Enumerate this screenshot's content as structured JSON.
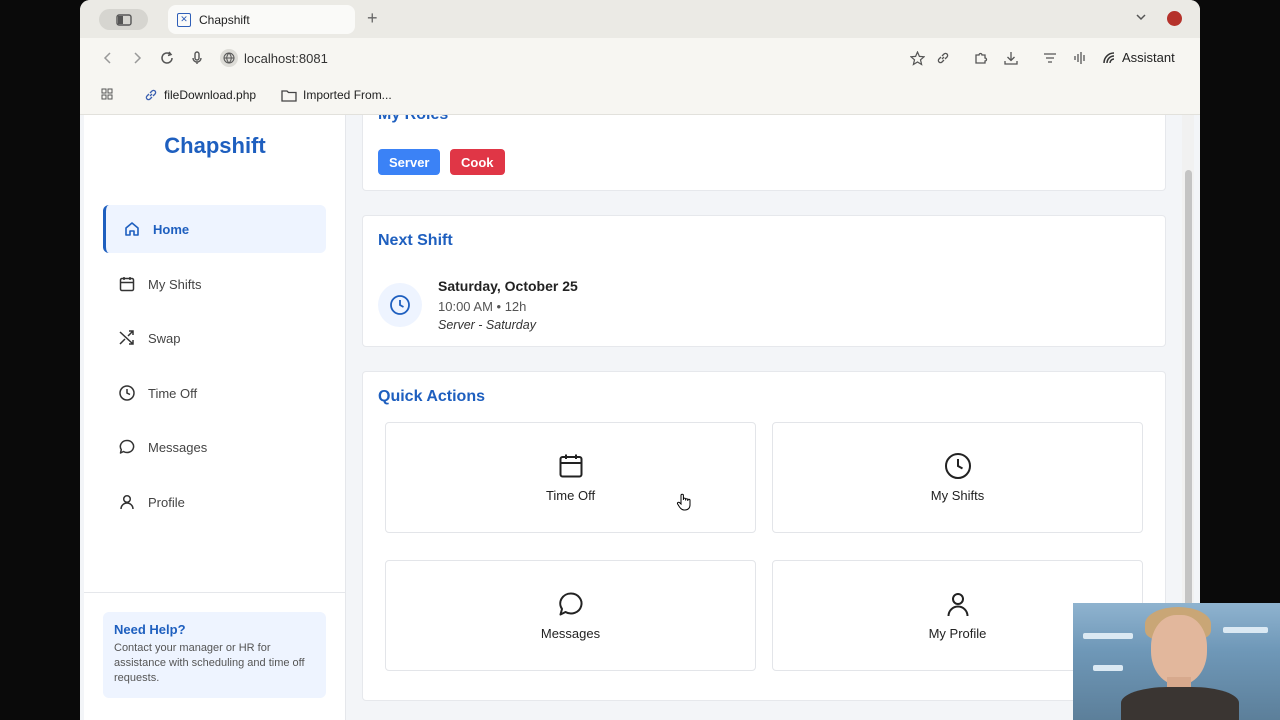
{
  "browser": {
    "tab_title": "Chapshift",
    "url": "localhost:8081",
    "assistant_label": "Assistant",
    "bookmarks": [
      {
        "label": "fileDownload.php",
        "icon": "link-icon"
      },
      {
        "label": "Imported From...",
        "icon": "folder-icon"
      }
    ]
  },
  "sidebar": {
    "brand": "Chapshift",
    "items": [
      {
        "label": "Home",
        "icon": "home-icon",
        "active": true
      },
      {
        "label": "My Shifts",
        "icon": "calendar-icon",
        "active": false
      },
      {
        "label": "Swap",
        "icon": "shuffle-icon",
        "active": false
      },
      {
        "label": "Time Off",
        "icon": "clock-icon",
        "active": false
      },
      {
        "label": "Messages",
        "icon": "chat-icon",
        "active": false
      },
      {
        "label": "Profile",
        "icon": "user-icon",
        "active": false
      }
    ],
    "help": {
      "title": "Need Help?",
      "text": "Contact your manager or HR for assistance with scheduling and time off requests."
    }
  },
  "roles_card": {
    "title": "My Roles",
    "roles": [
      {
        "label": "Server",
        "color": "#3b82f6"
      },
      {
        "label": "Cook",
        "color": "#e03646"
      }
    ]
  },
  "next_shift": {
    "title": "Next Shift",
    "date": "Saturday, October 25",
    "time": "10:00 AM • 12h",
    "role": "Server - Saturday"
  },
  "quick_actions": {
    "title": "Quick Actions",
    "tiles": [
      {
        "label": "Time Off",
        "icon": "calendar-icon"
      },
      {
        "label": "My Shifts",
        "icon": "clock-icon"
      },
      {
        "label": "Messages",
        "icon": "chat-icon"
      },
      {
        "label": "My Profile",
        "icon": "user-icon"
      }
    ]
  },
  "colors": {
    "brand": "#1e5fbf",
    "server": "#3b82f6",
    "cook": "#e03646"
  }
}
